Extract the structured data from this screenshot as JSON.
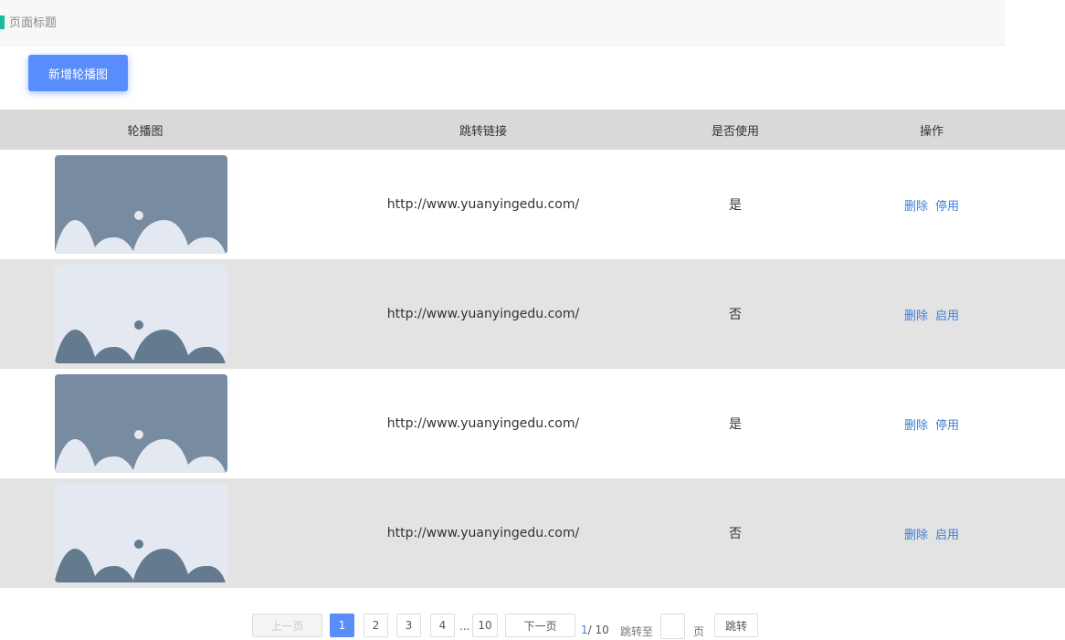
{
  "header": {
    "title": "页面标题"
  },
  "toolbar": {
    "add_label": "新增轮播图"
  },
  "table": {
    "columns": [
      "轮播图",
      "跳转链接",
      "是否使用",
      "操作"
    ],
    "rows": [
      {
        "image_style": "dark",
        "link": "http://www.yuanyingedu.com/",
        "enabled": "是",
        "delete_label": "删除",
        "toggle_label": "停用"
      },
      {
        "image_style": "light",
        "link": "http://www.yuanyingedu.com/",
        "enabled": "否",
        "delete_label": "删除",
        "toggle_label": "启用"
      },
      {
        "image_style": "dark",
        "link": "http://www.yuanyingedu.com/",
        "enabled": "是",
        "delete_label": "删除",
        "toggle_label": "停用"
      },
      {
        "image_style": "light",
        "link": "http://www.yuanyingedu.com/",
        "enabled": "否",
        "delete_label": "删除",
        "toggle_label": "启用"
      }
    ]
  },
  "pagination": {
    "prev_label": "上一页",
    "pages": [
      "1",
      "2",
      "3",
      "4"
    ],
    "ellipsis": "...",
    "last_page": "10",
    "next_label": "下一页",
    "current": "1",
    "total": "/ 10",
    "jump_label": "跳转至",
    "jump_value": "",
    "page_unit": "页",
    "jump_button": "跳转"
  },
  "colors": {
    "accent": "#5a8dfc",
    "header_marker": "#1abc9c",
    "link": "#3b7ed8",
    "image_dark_bg": "#778ba1",
    "image_dark_fg": "#e3e8f1",
    "image_light_bg": "#e3e8f1",
    "image_light_fg": "#647a8f"
  },
  "icons": {
    "image_placeholder": "image-placeholder-icon"
  }
}
